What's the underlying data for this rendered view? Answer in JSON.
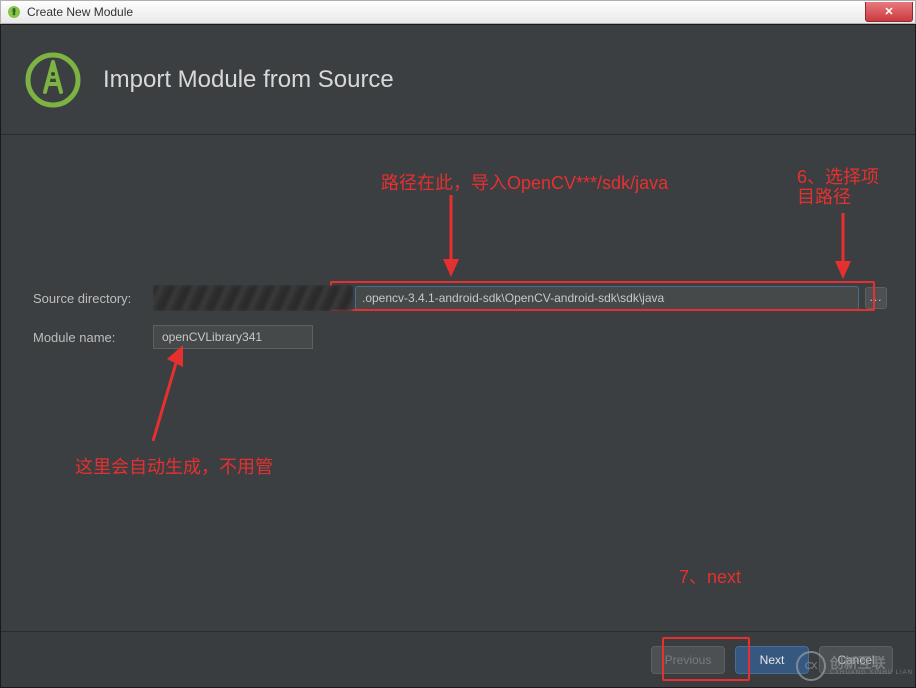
{
  "window": {
    "title": "Create New Module"
  },
  "header": {
    "title": "Import Module from Source"
  },
  "form": {
    "source_dir_label": "Source directory:",
    "source_dir_value": ".opencv-3.4.1-android-sdk\\OpenCV-android-sdk\\sdk\\java",
    "browse_label": "...",
    "module_name_label": "Module name:",
    "module_name_value": "openCVLibrary341"
  },
  "buttons": {
    "previous": "Previous",
    "next": "Next",
    "cancel": "Cancel"
  },
  "annotations": {
    "path_hint": "路径在此，导入OpenCV***/sdk/java",
    "step6": "6、选择项目路径",
    "auto_gen": "这里会自动生成，不用管",
    "step7": "7、next"
  },
  "watermark": {
    "brand": "创新互联",
    "sub": "CXHUANG XINHU LIAN"
  }
}
